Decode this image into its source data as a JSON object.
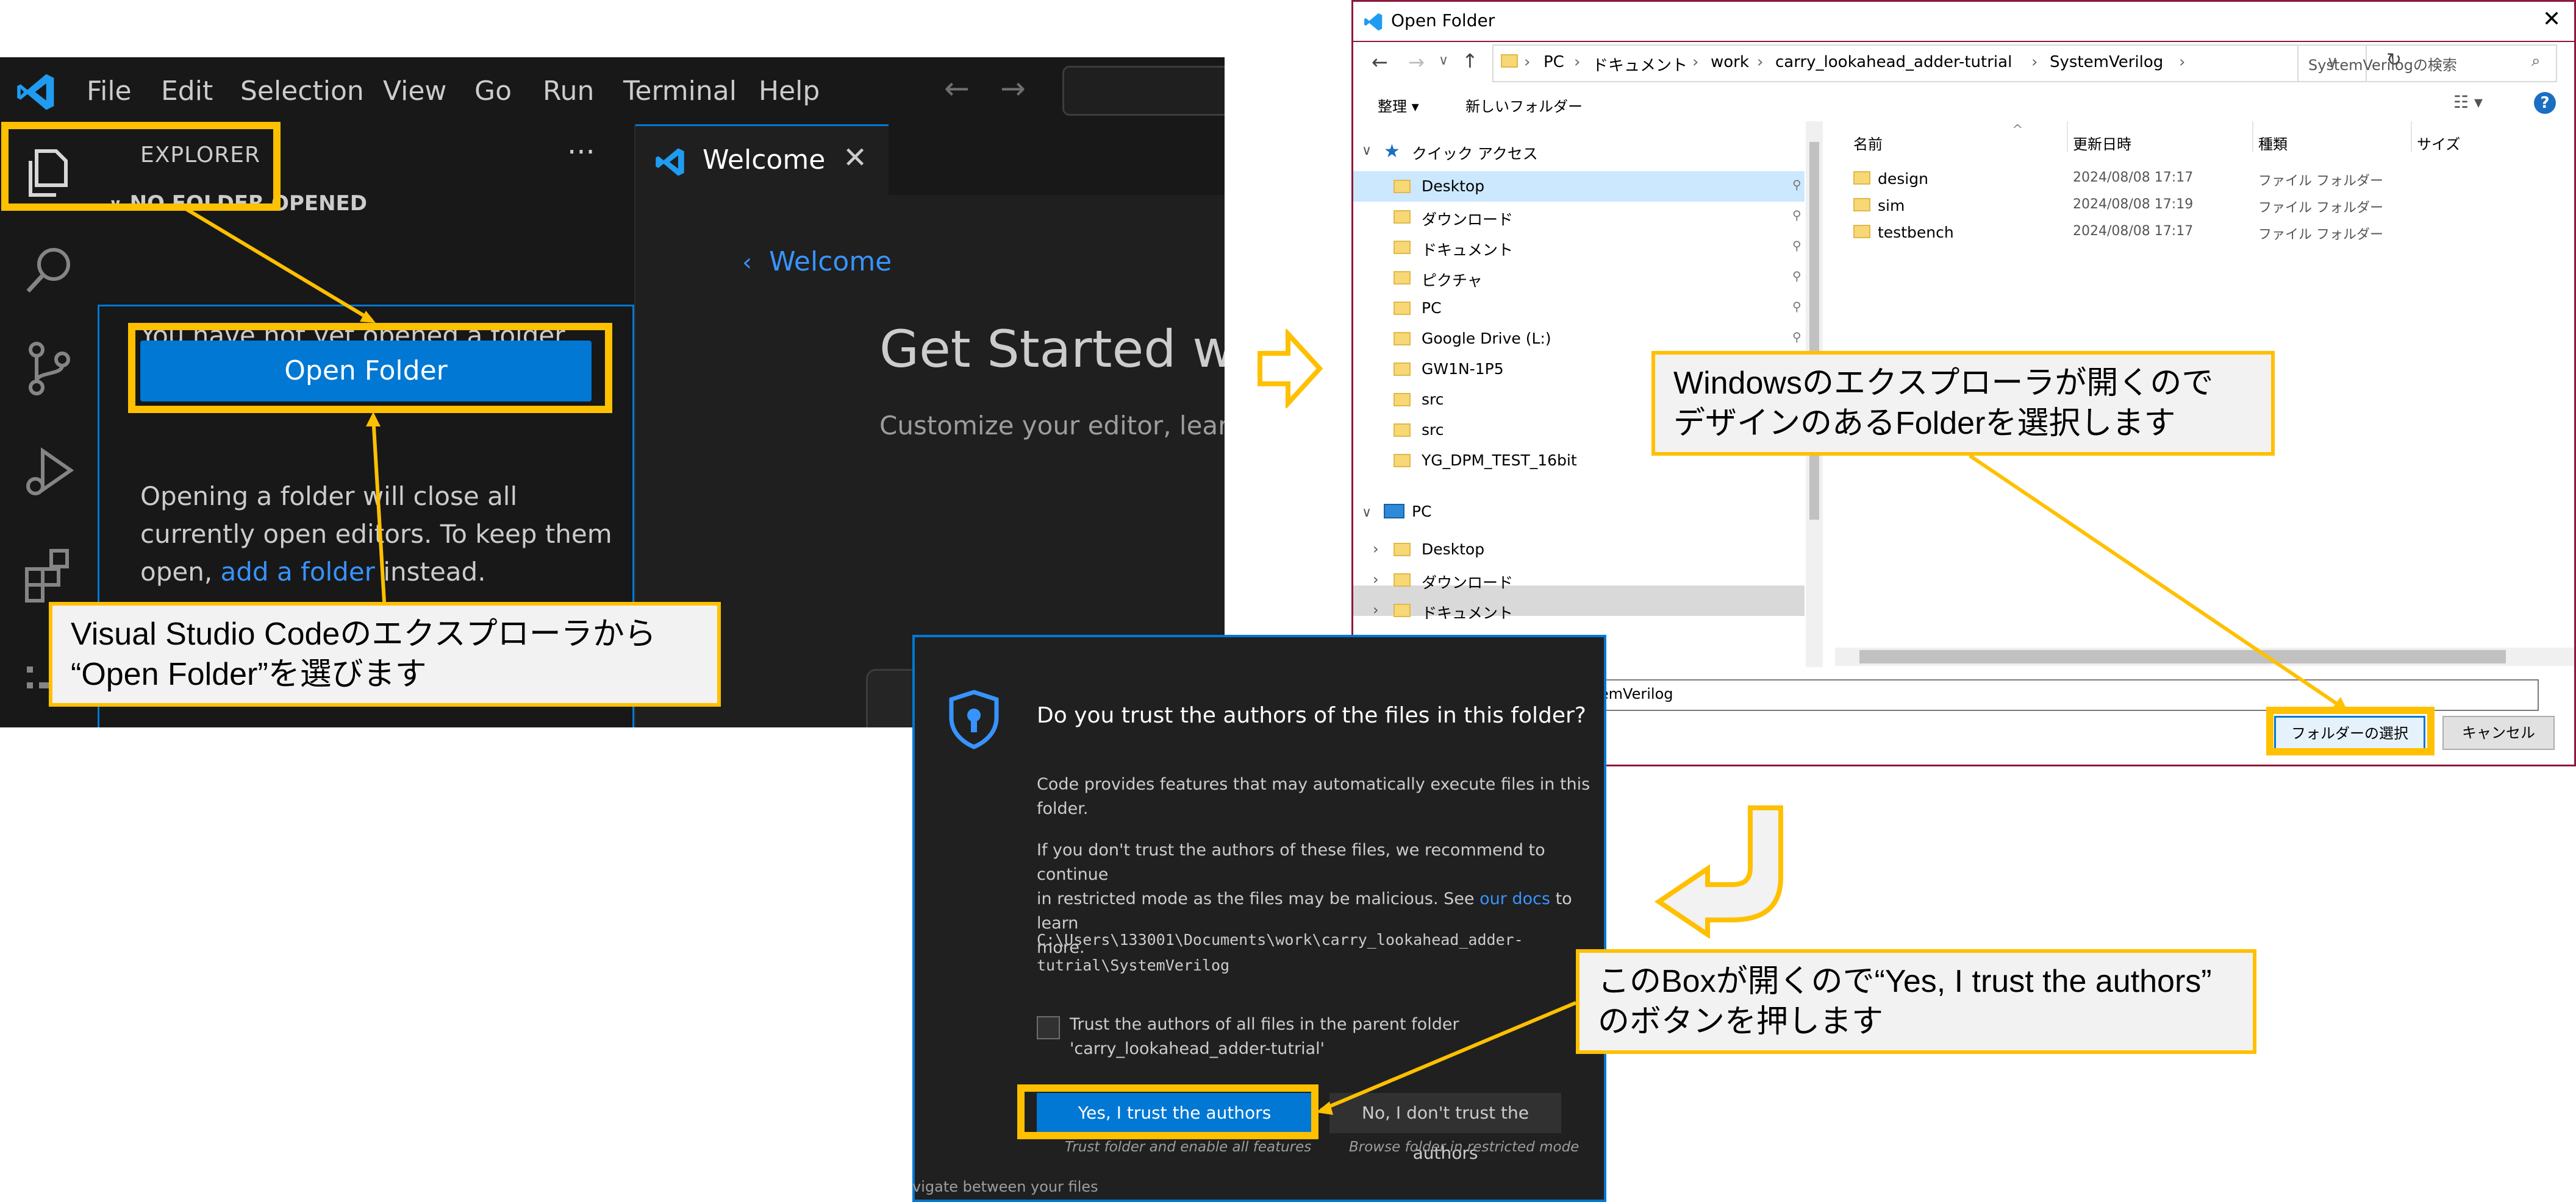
{
  "vscode": {
    "menu": [
      "File",
      "Edit",
      "Selection",
      "View",
      "Go",
      "Run",
      "Terminal",
      "Help"
    ],
    "explorer_title": "EXPLORER",
    "no_folder": "NO FOLDER OPENED",
    "not_opened": "You have not yet opened a folder.",
    "open_folder_btn": "Open Folder",
    "opening_line1": "Opening a folder will close all",
    "opening_line2": "currently open editors. To keep them",
    "opening_line3_a": "open,",
    "add_folder_link": "add a folder",
    "opening_line3_b": "instead.",
    "tab_label": "Welcome",
    "welcome_back": "Welcome",
    "get_started": "Get Started wit",
    "customize": "Customize your editor, learn"
  },
  "callouts": {
    "vscode_line1": "Visual Studio Codeのエクスプローラから",
    "vscode_line2": "“Open Folder”を選びます",
    "explorer_line1": "Windowsのエクスプローラが開くので",
    "explorer_line2": "デザインのあるFolderを選択します",
    "trust_line1": "このBoxが開くので“Yes, I trust the authors”",
    "trust_line2": "のボタンを押します"
  },
  "dialog": {
    "title": "Open Folder",
    "breadcrumb": [
      "PC",
      "ドキュメント",
      "work",
      "carry_lookahead_adder-tutrial",
      "SystemVerilog"
    ],
    "search_placeholder": "SystemVerilogの検索",
    "organize": "整理 ▾",
    "new_folder": "新しいフォルダー",
    "quick_access": "クイック アクセス",
    "nav_items": [
      "Desktop",
      "ダウンロード",
      "ドキュメント",
      "ピクチャ",
      "PC",
      "Google Drive (L:)",
      "GW1N-1P5",
      "src",
      "src",
      "YG_DPM_TEST_16bit"
    ],
    "pc_label": "PC",
    "pc_items": [
      "Desktop",
      "ダウンロード",
      "ドキュメント"
    ],
    "col_name": "名前",
    "col_date": "更新日時",
    "col_type": "種類",
    "col_size": "サイズ",
    "files": [
      {
        "name": "design",
        "date": "2024/08/08 17:17",
        "type": "ファイル フォルダー"
      },
      {
        "name": "sim",
        "date": "2024/08/08 17:19",
        "type": "ファイル フォルダー"
      },
      {
        "name": "testbench",
        "date": "2024/08/08 17:17",
        "type": "ファイル フォルダー"
      }
    ],
    "folder_value": "stemVerilog",
    "select_btn": "フォルダーの選択",
    "cancel_btn": "キャンセル",
    "help": "?"
  },
  "trust": {
    "title": "Do you trust the authors of the files in this folder?",
    "p1_l1": "Code provides features that may automatically execute files in this",
    "p1_l2": "folder.",
    "p2_l1": "If you don't trust the authors of these files, we recommend to continue",
    "p2_l2a": "in restricted mode as the files may be malicious. See",
    "p2_link": "our docs",
    "p2_l2b": "to learn",
    "p2_l3": "more.",
    "path_l1": "C:\\Users\\133001\\Documents\\work\\carry_lookahead_adder-",
    "path_l2": "tutrial\\SystemVerilog",
    "check_l1": "Trust the authors of all files in the parent folder",
    "check_l2": "'carry_lookahead_adder-tutrial'",
    "yes_btn": "Yes, I trust the authors",
    "yes_sub": "Trust folder and enable all features",
    "no_btn": "No, I don't trust the authors",
    "no_sub": "Browse folder in restricted mode",
    "bottom_fragment": "vigate between your files"
  }
}
